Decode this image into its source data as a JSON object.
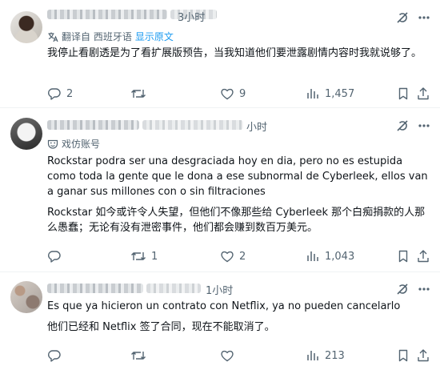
{
  "posts": [
    {
      "time": "3小时",
      "translated_from": "翻译自 西班牙语",
      "show_original": "显示原文",
      "text_lines": [
        "我停止看剧透是为了看扩展版预告，当我知道他们要泄露剧情内容时我就说够了。"
      ],
      "replies": "2",
      "reposts": "",
      "likes": "9",
      "views": "1,457"
    },
    {
      "time": "小时",
      "account_label": "戏仿账号",
      "text_lines": [
        "Rockstar podra ser una desgraciada hoy en dia, pero no es estupida como toda la gente que le dona a ese subnormal de Cyberleek, ellos van a ganar sus millones con o sin filtraciones",
        "Rockstar 如今或许令人失望，但他们不像那些给 Cyberleek 那个白痴捐款的人那么愚蠢；无论有没有泄密事件，他们都会赚到数百万美元。"
      ],
      "replies": "",
      "reposts": "1",
      "likes": "2",
      "views": "1,043"
    },
    {
      "time": "1小时",
      "text_lines": [
        "Es que ya hicieron un contrato con Netflix, ya no pueden cancelarlo",
        "他们已经和 Netflix 签了合同，现在不能取消了。"
      ],
      "replies": "",
      "reposts": "",
      "likes": "",
      "views": "213"
    }
  ],
  "icons": {
    "grok": "grok-icon",
    "more": "more-icon",
    "translate": "translate-icon",
    "parody": "parody-mask-icon",
    "reply": "reply-icon",
    "repost": "repost-icon",
    "like": "like-icon",
    "views": "views-icon",
    "bookmark": "bookmark-icon",
    "share": "share-icon"
  },
  "colors": {
    "text": "#0f1419",
    "secondary": "#536471",
    "link": "#1d9bf0",
    "divider": "#eff3f4"
  }
}
